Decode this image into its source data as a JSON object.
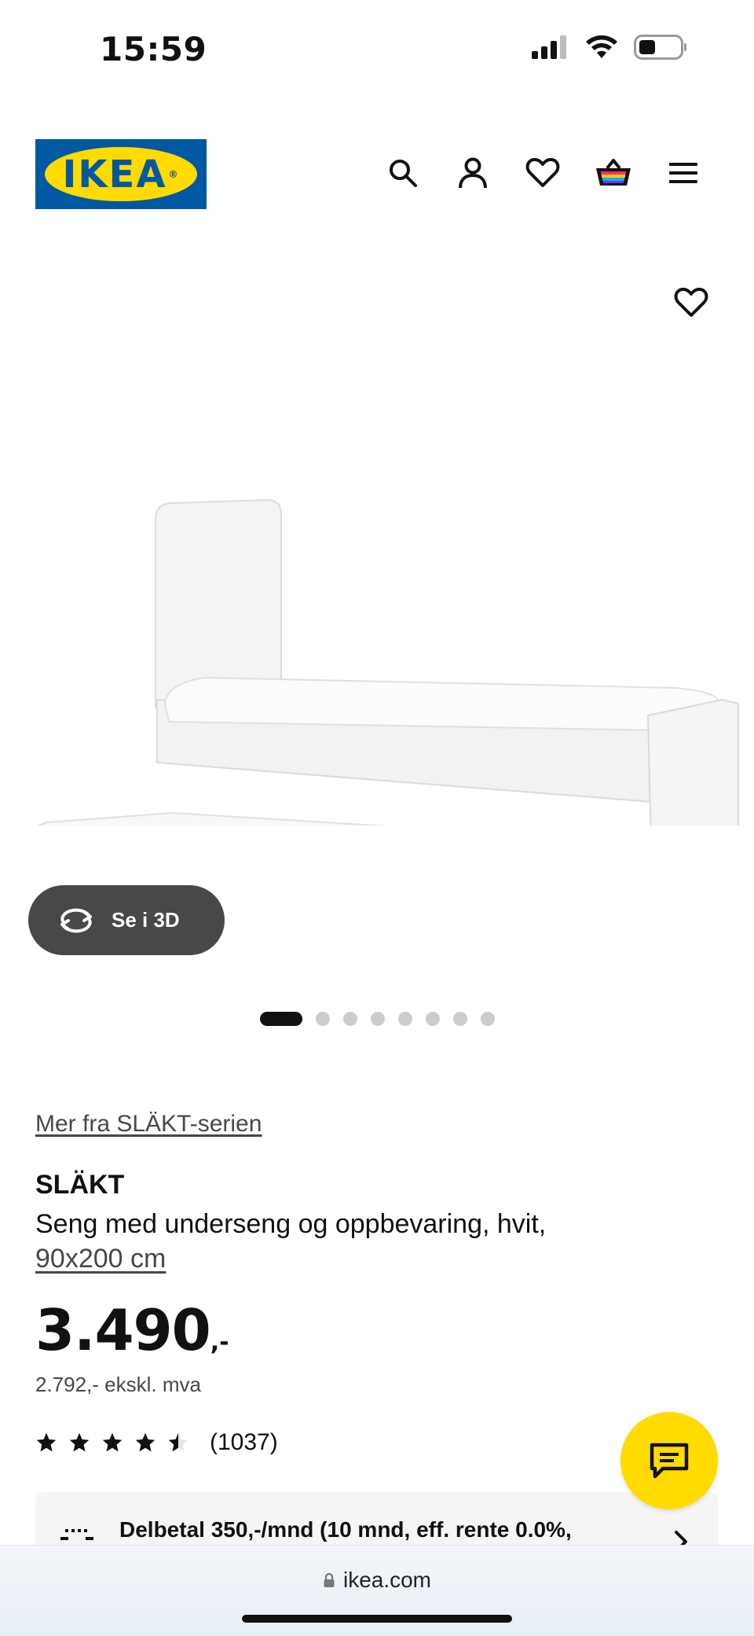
{
  "status_bar": {
    "time": "15:59"
  },
  "header": {
    "logo_text": "IKEA",
    "logo_reg": "®",
    "icons": [
      "search-icon",
      "account-icon",
      "wishlist-icon",
      "cart-icon",
      "menu-icon"
    ]
  },
  "gallery": {
    "view_3d_label": "Se i 3D",
    "current_index": 1,
    "total_images": 8
  },
  "product": {
    "series_link": "Mer fra SLÄKT-serien",
    "name": "SLÄKT",
    "description": "Seng med underseng og oppbevaring, hvit,",
    "size": "90x200 cm",
    "price_main": "3.490",
    "price_suffix": ",-",
    "price_ex_vat": "2.792,- ekskl. mva",
    "rating_value": 4.5,
    "rating_count": "(1037)"
  },
  "financing": {
    "text": "Delbetal 350,-/mnd (10 mnd, eff. rente 0.0%,"
  },
  "browser": {
    "url": "ikea.com"
  },
  "colors": {
    "ikea_blue": "#0058a3",
    "ikea_yellow": "#ffdb00",
    "button_dark": "#484848"
  }
}
